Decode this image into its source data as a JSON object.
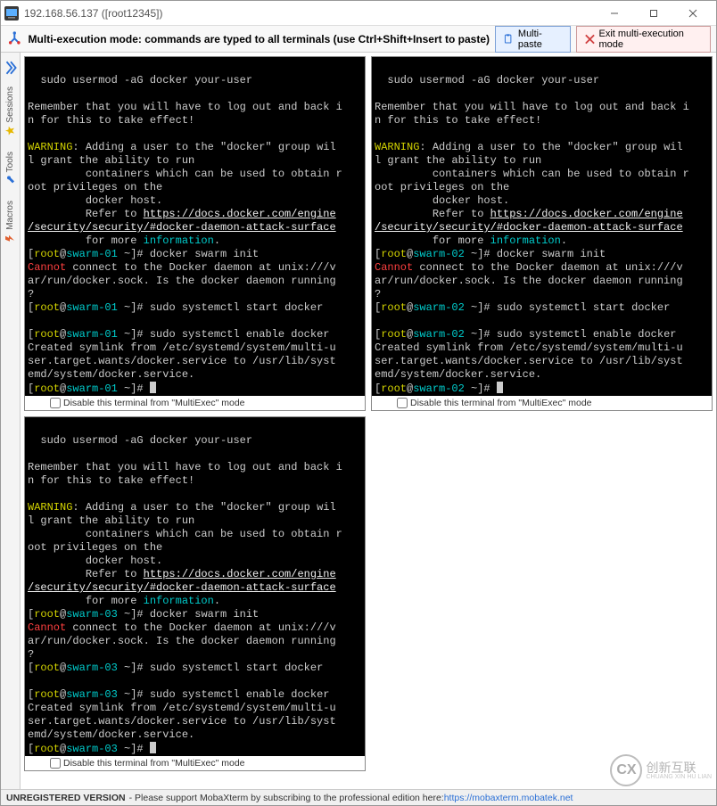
{
  "titlebar": {
    "title": "192.168.56.137 ([root12345])"
  },
  "toolbar": {
    "mode_text": "Multi-execution mode: commands are typed to all terminals (use Ctrl+Shift+Insert to paste)",
    "multipaste": "Multi-paste",
    "exit": "Exit multi-execution mode"
  },
  "sidebar": {
    "tabs": [
      {
        "label": "Sessions",
        "color": "#e6b800"
      },
      {
        "label": "Tools",
        "color": "#2a6fd6"
      },
      {
        "label": "Macros",
        "color": "#e06030"
      }
    ]
  },
  "terminal_common": {
    "cmd_usermod": "  sudo usermod -aG docker your-user",
    "remember_line1": "Remember that you will have to log out and back i",
    "remember_line2": "n for this to take effect!",
    "warning_word": "WARNING",
    "warning_l1": ": Adding a user to the \"docker\" group wil",
    "warning_l2": "l grant the ability to run",
    "warning_l3": "         containers which can be used to obtain r",
    "warning_l4": "oot privileges on the",
    "warning_l5": "         docker host.",
    "refer": "         Refer to ",
    "url_l1": "https://docs.docker.com/engine",
    "url_l2": "/security/security/#docker-daemon-attack-surface",
    "for_more": "         for more ",
    "information": "information",
    "period": ".",
    "cmd_swarm": " docker swarm init",
    "cannot_word": "Cannot",
    "cannot_l1": " connect to the Docker daemon at unix:///v",
    "cannot_l2": "ar/run/docker.sock. Is the docker daemon running",
    "cannot_l3": "?",
    "cmd_start": " sudo systemctl start docker",
    "cmd_enable": " sudo systemctl enable docker",
    "symlink_l1": "Created symlink from /etc/systemd/system/multi-u",
    "symlink_l2": "ser.target.wants/docker.service to /usr/lib/syst",
    "symlink_l3": "emd/system/docker.service.",
    "prompt_root": "root",
    "prompt_at": "@",
    "prompt_tail": " ~]#",
    "prompt_open": "["
  },
  "panes": [
    {
      "host": "swarm-01"
    },
    {
      "host": "swarm-02"
    },
    {
      "host": "swarm-03"
    }
  ],
  "disable_label": "Disable this terminal from \"MultiExec\" mode",
  "status": {
    "bold": "UNREGISTERED VERSION",
    "text": " - Please support MobaXterm by subscribing to the professional edition here: ",
    "link": "https://mobaxterm.mobatek.net"
  },
  "watermark": {
    "chars": "创新互联",
    "ruby": "CHUANG XIN HU LIAN",
    "cx": "CX"
  }
}
